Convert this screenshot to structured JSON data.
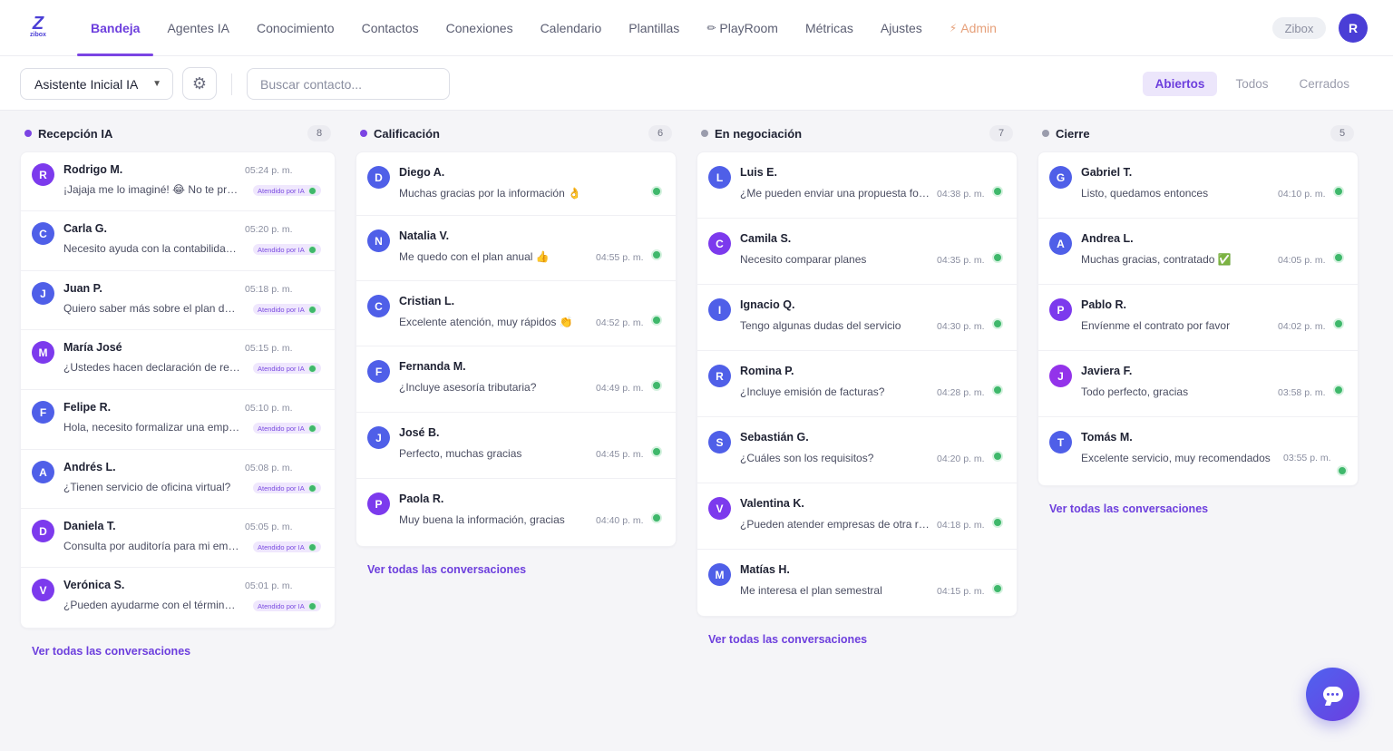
{
  "app": {
    "logo_letter": "Z",
    "logo_text": "zibox",
    "brand_label": "Zibox",
    "user_initial": "R"
  },
  "nav": [
    {
      "label": "Bandeja",
      "active": true
    },
    {
      "label": "Agentes IA"
    },
    {
      "label": "Conocimiento"
    },
    {
      "label": "Contactos"
    },
    {
      "label": "Conexiones"
    },
    {
      "label": "Calendario"
    },
    {
      "label": "Plantillas"
    },
    {
      "label": "PlayRoom",
      "icon": "pencil-icon"
    },
    {
      "label": "Métricas"
    },
    {
      "label": "Ajustes"
    },
    {
      "label": "Admin",
      "icon": "lightning-icon"
    }
  ],
  "toolbar": {
    "agent_select": "Asistente Inicial IA",
    "search_placeholder": "Buscar contacto...",
    "filters": [
      "Abiertos",
      "Todos",
      "Cerrados"
    ],
    "active_filter": "Abiertos"
  },
  "colors": {
    "accent": "#6d3fdd",
    "whatsapp": "#3fb86b",
    "stage_active": "#7b44e3",
    "stage_inactive": "#9a9cac"
  },
  "view_all_label": "Ver todas las conversaciones",
  "ai_badge_label": "Atendido por IA",
  "columns": [
    {
      "title": "Recepción IA",
      "count": "8",
      "dot": "#7b44e3",
      "items": [
        {
          "initial": "R",
          "name": "Rodrigo M.",
          "message": "¡Jajaja me lo imaginé! 😂 No te preocupes",
          "time": "05:24 p. m.",
          "color": "#7c3aed"
        },
        {
          "initial": "C",
          "name": "Carla G.",
          "message": "Necesito ayuda con la contabilidad de mi empresa",
          "time": "05:20 p. m.",
          "color": "#4f5fe8"
        },
        {
          "initial": "J",
          "name": "Juan P.",
          "message": "Quiero saber más sobre el plan de contabilidad",
          "time": "05:18 p. m.",
          "color": "#4f5fe8"
        },
        {
          "initial": "M",
          "name": "María José",
          "message": "¿Ustedes hacen declaración de renta?",
          "time": "05:15 p. m.",
          "color": "#7c3aed"
        },
        {
          "initial": "F",
          "name": "Felipe R.",
          "message": "Hola, necesito formalizar una empresa",
          "time": "05:10 p. m.",
          "color": "#4f5fe8"
        },
        {
          "initial": "A",
          "name": "Andrés L.",
          "message": "¿Tienen servicio de oficina virtual?",
          "time": "05:08 p. m.",
          "color": "#4f5fe8"
        },
        {
          "initial": "D",
          "name": "Daniela T.",
          "message": "Consulta por auditoría para mi empresa",
          "time": "05:05 p. m.",
          "color": "#7c3aed"
        },
        {
          "initial": "V",
          "name": "Verónica S.",
          "message": "¿Pueden ayudarme con el término de giro?",
          "time": "05:01 p. m.",
          "color": "#7c3aed"
        }
      ]
    },
    {
      "title": "Calificación",
      "count": "6",
      "dot": "#7b44e3",
      "items": [
        {
          "initial": "D",
          "name": "Diego A.",
          "message": "Muchas gracias por la información 👌",
          "time": "",
          "color": "#4f5fe8"
        },
        {
          "initial": "N",
          "name": "Natalia V.",
          "message": "Me quedo con el plan anual 👍",
          "time": "04:55 p. m.",
          "color": "#4f5fe8"
        },
        {
          "initial": "C",
          "name": "Cristian L.",
          "message": "Excelente atención, muy rápidos 👏",
          "time": "04:52 p. m.",
          "color": "#4f5fe8"
        },
        {
          "initial": "F",
          "name": "Fernanda M.",
          "message": "¿Incluye asesoría tributaria?",
          "time": "04:49 p. m.",
          "color": "#4f5fe8"
        },
        {
          "initial": "J",
          "name": "José B.",
          "message": "Perfecto, muchas gracias",
          "time": "04:45 p. m.",
          "color": "#4f5fe8"
        },
        {
          "initial": "P",
          "name": "Paola R.",
          "message": "Muy buena la información, gracias",
          "time": "04:40 p. m.",
          "color": "#7c3aed"
        }
      ]
    },
    {
      "title": "En negociación",
      "count": "7",
      "dot": "#9a9cac",
      "items": [
        {
          "initial": "L",
          "name": "Luis E.",
          "message": "¿Me pueden enviar una propuesta formal?",
          "time": "04:38 p. m.",
          "color": "#4f5fe8"
        },
        {
          "initial": "C",
          "name": "Camila S.",
          "message": "Necesito comparar planes",
          "time": "04:35 p. m.",
          "color": "#7c3aed"
        },
        {
          "initial": "I",
          "name": "Ignacio Q.",
          "message": "Tengo algunas dudas del servicio",
          "time": "04:30 p. m.",
          "color": "#4f5fe8"
        },
        {
          "initial": "R",
          "name": "Romina P.",
          "message": "¿Incluye emisión de facturas?",
          "time": "04:28 p. m.",
          "color": "#4f5fe8"
        },
        {
          "initial": "S",
          "name": "Sebastián G.",
          "message": "¿Cuáles son los requisitos?",
          "time": "04:20 p. m.",
          "color": "#4f5fe8"
        },
        {
          "initial": "V",
          "name": "Valentina K.",
          "message": "¿Pueden atender empresas de otra región?",
          "time": "04:18 p. m.",
          "color": "#7c3aed"
        },
        {
          "initial": "M",
          "name": "Matías H.",
          "message": "Me interesa el plan semestral",
          "time": "04:15 p. m.",
          "color": "#4f5fe8"
        }
      ]
    },
    {
      "title": "Cierre",
      "count": "5",
      "dot": "#9a9cac",
      "items": [
        {
          "initial": "G",
          "name": "Gabriel T.",
          "message": "Listo, quedamos entonces",
          "time": "04:10 p. m.",
          "color": "#4f5fe8"
        },
        {
          "initial": "A",
          "name": "Andrea L.",
          "message": "Muchas gracias, contratado ✅",
          "time": "04:05 p. m.",
          "color": "#4f5fe8"
        },
        {
          "initial": "P",
          "name": "Pablo R.",
          "message": "Envíenme el contrato por favor",
          "time": "04:02 p. m.",
          "color": "#7c3aed"
        },
        {
          "initial": "J",
          "name": "Javiera F.",
          "message": "Todo perfecto, gracias",
          "time": "03:58 p. m.",
          "color": "#9333ea"
        },
        {
          "initial": "T",
          "name": "Tomás M.",
          "message": "Excelente servicio, muy recomendados",
          "time": "03:55 p. m.",
          "color": "#4f5fe8"
        }
      ]
    }
  ]
}
